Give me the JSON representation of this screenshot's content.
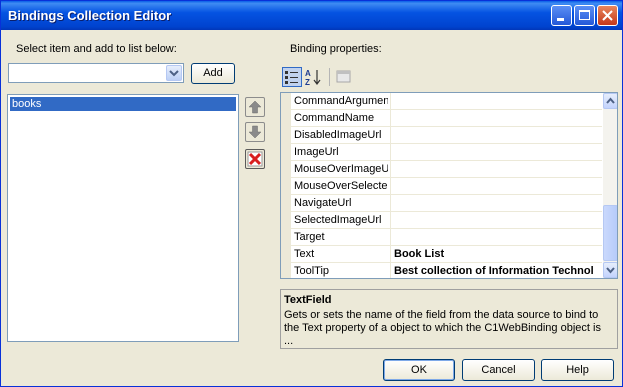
{
  "window": {
    "title": "Bindings Collection Editor"
  },
  "left": {
    "select_label": "Select item and add to list below:",
    "combo_value": "",
    "add_label": "Add",
    "list_items": [
      "books"
    ]
  },
  "right": {
    "props_label": "Binding properties:",
    "rows": [
      {
        "name": "CommandArgument",
        "value": ""
      },
      {
        "name": "CommandName",
        "value": ""
      },
      {
        "name": "DisabledImageUrl",
        "value": ""
      },
      {
        "name": "ImageUrl",
        "value": ""
      },
      {
        "name": "MouseOverImageUr",
        "value": ""
      },
      {
        "name": "MouseOverSelectec",
        "value": ""
      },
      {
        "name": "NavigateUrl",
        "value": ""
      },
      {
        "name": "SelectedImageUrl",
        "value": ""
      },
      {
        "name": "Target",
        "value": ""
      },
      {
        "name": "Text",
        "value": "Book List"
      },
      {
        "name": "ToolTip",
        "value": "Best collection of Information Technol"
      }
    ],
    "desc_title": "TextField",
    "desc_text": "Gets or sets the name of the field from the data source to bind to the Text property of a object to which the C1WebBinding object is  ..."
  },
  "buttons": {
    "ok": "OK",
    "cancel": "Cancel",
    "help": "Help"
  },
  "icons": [
    "minimize-icon",
    "maximize-icon",
    "close-icon",
    "dropdown-arrow-icon",
    "move-up-icon",
    "move-down-icon",
    "delete-icon",
    "categorized-icon",
    "alphabetical-icon",
    "property-pages-icon"
  ]
}
